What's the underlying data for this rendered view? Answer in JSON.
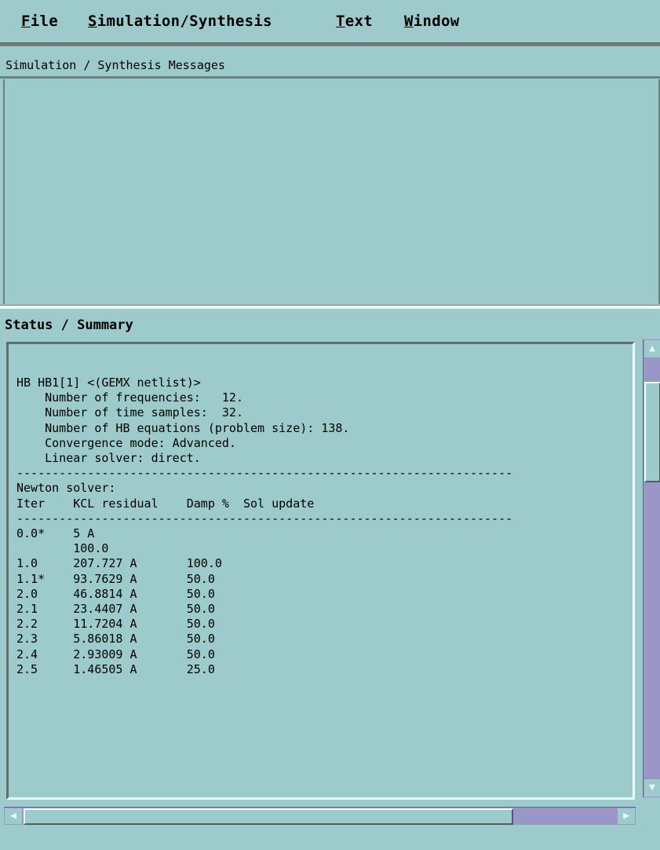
{
  "menu": {
    "items": [
      {
        "mnemonic": "F",
        "rest": "ile"
      },
      {
        "mnemonic": "S",
        "rest": "imulation/Synthesis"
      },
      {
        "mnemonic": "T",
        "rest": "ext"
      },
      {
        "mnemonic": "W",
        "rest": "indow"
      }
    ]
  },
  "messages": {
    "title": "Simulation / Synthesis Messages",
    "content": ""
  },
  "status": {
    "title": "Status / Summary",
    "lines": [
      "HB HB1[1] <(GEMX netlist)>",
      "    Number of frequencies:   12.",
      "    Number of time samples:  32.",
      "    Number of HB equations (problem size): 138.",
      "    Convergence mode: Advanced.",
      "    Linear solver: direct.",
      "----------------------------------------------------------------------",
      "Newton solver:",
      "Iter    KCL residual    Damp %  Sol update",
      "----------------------------------------------------------------------",
      "0.0*    5 A",
      "        100.0",
      "1.0     207.727 A       100.0",
      "1.1*    93.7629 A       50.0",
      "2.0     46.8814 A       50.0",
      "2.1     23.4407 A       50.0",
      "2.2     11.7204 A       50.0",
      "2.3     5.86018 A       50.0",
      "2.4     2.93009 A       50.0",
      "2.5     1.46505 A       25.0"
    ]
  },
  "scrollbars": {
    "vertical": {
      "up_icon": "triangle-up-icon",
      "down_icon": "triangle-down-icon"
    },
    "horizontal": {
      "left_icon": "triangle-left-icon",
      "right_icon": "triangle-right-icon"
    }
  },
  "colors": {
    "background": "#9dcbcb",
    "scroll_track": "#9a96c8",
    "shadow": "#5f6f6f",
    "highlight": "#eaffff"
  }
}
